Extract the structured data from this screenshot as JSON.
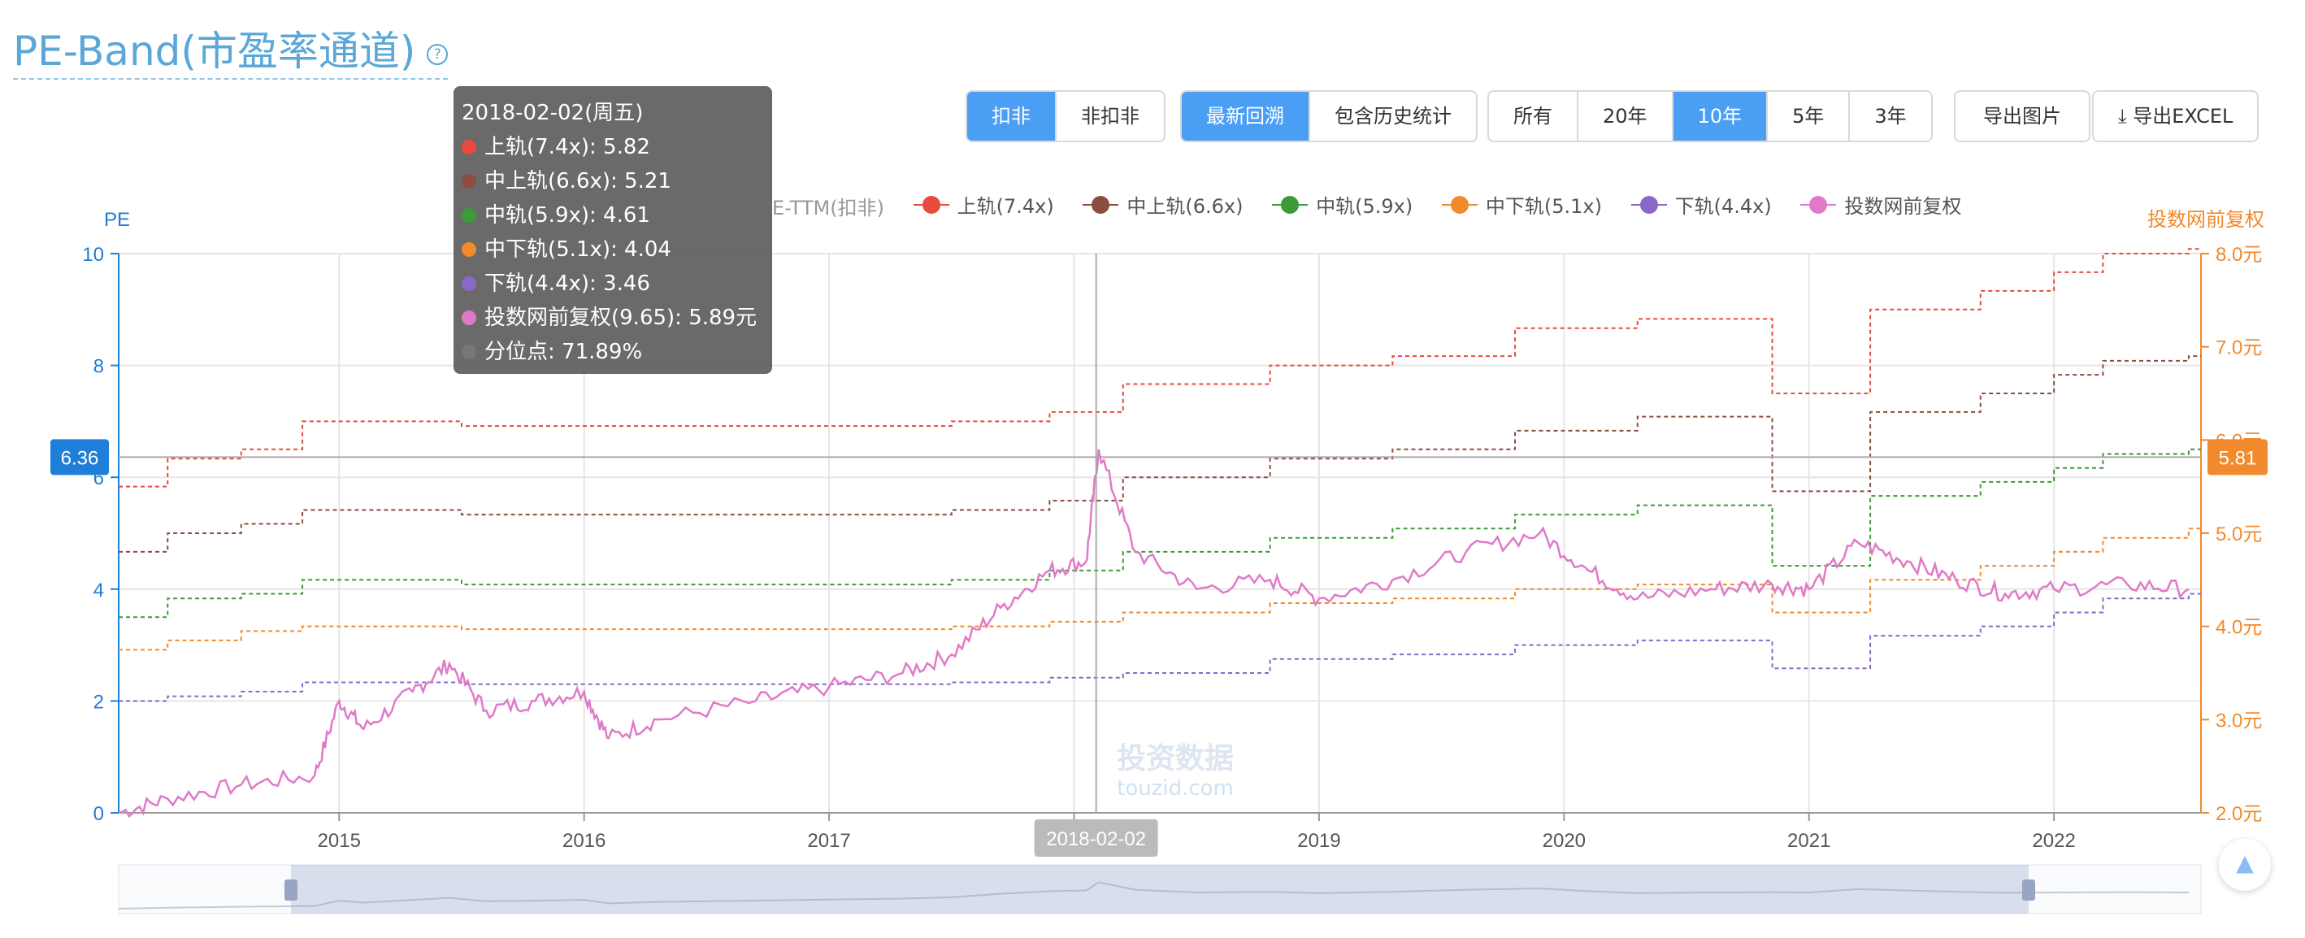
{
  "title": "PE-Band(市盈率通道)",
  "help_icon": "question-circle-icon",
  "controls": {
    "deduct_group": [
      {
        "label": "扣非",
        "active": true
      },
      {
        "label": "非扣非",
        "active": false
      }
    ],
    "method_group": [
      {
        "label": "最新回溯",
        "active": true
      },
      {
        "label": "包含历史统计",
        "active": false
      }
    ],
    "range_group": [
      {
        "label": "所有",
        "active": false
      },
      {
        "label": "20年",
        "active": false
      },
      {
        "label": "10年",
        "active": true
      },
      {
        "label": "5年",
        "active": false
      },
      {
        "label": "3年",
        "active": false
      }
    ],
    "export_image": "导出图片",
    "export_excel": "导出EXCEL",
    "export_excel_icon": "download-icon"
  },
  "legend_partial": "E-TTM(扣非)",
  "tooltip": {
    "date": "2018-02-02(周五)",
    "rows": [
      {
        "text": "上轨(7.4x): 5.82",
        "color": "#e84a3d"
      },
      {
        "text": "中上轨(6.6x): 5.21",
        "color": "#8b4d3f"
      },
      {
        "text": "中轨(5.9x): 4.61",
        "color": "#3b9b37"
      },
      {
        "text": "中下轨(5.1x): 4.04",
        "color": "#f08a2c"
      },
      {
        "text": "下轨(4.4x): 3.46",
        "color": "#8a68c8"
      },
      {
        "text": "投数网前复权(9.65): 5.89元",
        "color": "#e07ac8"
      },
      {
        "text": "分位点: 71.89%",
        "color": "#777777"
      }
    ]
  },
  "crosshair": {
    "left_value": "6.36",
    "right_value": "5.81",
    "x_label": "2018-02-02",
    "x_date": 2018.09
  },
  "watermark": {
    "main": "投资数据",
    "sub": "touzid.com"
  },
  "chart_data": {
    "type": "line",
    "x_ticks": [
      "2015",
      "2016",
      "2017",
      "2018",
      "2019",
      "2020",
      "2021",
      "2022"
    ],
    "x_range": [
      2014.1,
      2022.6
    ],
    "y_left": {
      "label": "PE",
      "range": [
        0,
        10
      ],
      "ticks": [
        "0",
        "2",
        "4",
        "6",
        "8",
        "10"
      ],
      "color": "#1f7ed8"
    },
    "y_right": {
      "label": "投数网前复权",
      "range": [
        2.0,
        8.0
      ],
      "ticks": [
        "2.0元",
        "3.0元",
        "4.0元",
        "5.0元",
        "6.0元",
        "7.0元",
        "8.0元"
      ],
      "color": "#f08a2c"
    },
    "legend": [
      {
        "name": "上轨(7.4x)",
        "color": "#e84a3d"
      },
      {
        "name": "中上轨(6.6x)",
        "color": "#8b4d3f"
      },
      {
        "name": "中轨(5.9x)",
        "color": "#3b9b37"
      },
      {
        "name": "中下轨(5.1x)",
        "color": "#f08a2c"
      },
      {
        "name": "下轨(4.4x)",
        "color": "#8a68c8"
      },
      {
        "name": "投数网前复权",
        "color": "#e07ac8"
      }
    ],
    "band_series": [
      {
        "name": "上轨(7.4x)",
        "color": "#e84a3d",
        "points": [
          [
            2014.1,
            5.5
          ],
          [
            2014.3,
            5.8
          ],
          [
            2014.6,
            5.9
          ],
          [
            2014.85,
            6.2
          ],
          [
            2015.5,
            6.15
          ],
          [
            2017.5,
            6.2
          ],
          [
            2017.9,
            6.3
          ],
          [
            2018.2,
            6.6
          ],
          [
            2018.8,
            6.8
          ],
          [
            2019.3,
            6.9
          ],
          [
            2019.8,
            7.2
          ],
          [
            2020.3,
            7.3
          ],
          [
            2020.85,
            6.5
          ],
          [
            2021.25,
            7.4
          ],
          [
            2021.7,
            7.6
          ],
          [
            2022.0,
            7.8
          ],
          [
            2022.2,
            8.0
          ],
          [
            2022.55,
            8.05
          ]
        ]
      },
      {
        "name": "中上轨(6.6x)",
        "color": "#8b4d3f",
        "points": [
          [
            2014.1,
            4.8
          ],
          [
            2014.3,
            5.0
          ],
          [
            2014.6,
            5.1
          ],
          [
            2014.85,
            5.25
          ],
          [
            2015.5,
            5.2
          ],
          [
            2017.5,
            5.25
          ],
          [
            2017.9,
            5.35
          ],
          [
            2018.2,
            5.6
          ],
          [
            2018.8,
            5.8
          ],
          [
            2019.3,
            5.9
          ],
          [
            2019.8,
            6.1
          ],
          [
            2020.3,
            6.25
          ],
          [
            2020.85,
            5.45
          ],
          [
            2021.25,
            6.3
          ],
          [
            2021.7,
            6.5
          ],
          [
            2022.0,
            6.7
          ],
          [
            2022.2,
            6.85
          ],
          [
            2022.55,
            6.9
          ]
        ]
      },
      {
        "name": "中轨(5.9x)",
        "color": "#3b9b37",
        "points": [
          [
            2014.1,
            4.1
          ],
          [
            2014.3,
            4.3
          ],
          [
            2014.6,
            4.35
          ],
          [
            2014.85,
            4.5
          ],
          [
            2015.5,
            4.45
          ],
          [
            2017.5,
            4.5
          ],
          [
            2017.9,
            4.6
          ],
          [
            2018.2,
            4.8
          ],
          [
            2018.8,
            4.95
          ],
          [
            2019.3,
            5.05
          ],
          [
            2019.8,
            5.2
          ],
          [
            2020.3,
            5.3
          ],
          [
            2020.85,
            4.65
          ],
          [
            2021.25,
            5.4
          ],
          [
            2021.7,
            5.55
          ],
          [
            2022.0,
            5.7
          ],
          [
            2022.2,
            5.85
          ],
          [
            2022.55,
            5.9
          ]
        ]
      },
      {
        "name": "中下轨(5.1x)",
        "color": "#f08a2c",
        "points": [
          [
            2014.1,
            3.75
          ],
          [
            2014.3,
            3.85
          ],
          [
            2014.6,
            3.95
          ],
          [
            2014.85,
            4.0
          ],
          [
            2015.5,
            3.97
          ],
          [
            2017.5,
            4.0
          ],
          [
            2017.9,
            4.05
          ],
          [
            2018.2,
            4.15
          ],
          [
            2018.8,
            4.25
          ],
          [
            2019.3,
            4.3
          ],
          [
            2019.8,
            4.4
          ],
          [
            2020.3,
            4.45
          ],
          [
            2020.85,
            4.15
          ],
          [
            2021.25,
            4.5
          ],
          [
            2021.7,
            4.65
          ],
          [
            2022.0,
            4.8
          ],
          [
            2022.2,
            4.95
          ],
          [
            2022.55,
            5.05
          ]
        ]
      },
      {
        "name": "下轨(4.4x)",
        "color": "#8a68c8",
        "points": [
          [
            2014.1,
            3.2
          ],
          [
            2014.3,
            3.25
          ],
          [
            2014.6,
            3.3
          ],
          [
            2014.85,
            3.4
          ],
          [
            2015.5,
            3.38
          ],
          [
            2017.5,
            3.4
          ],
          [
            2017.9,
            3.45
          ],
          [
            2018.2,
            3.5
          ],
          [
            2018.8,
            3.65
          ],
          [
            2019.3,
            3.7
          ],
          [
            2019.8,
            3.8
          ],
          [
            2020.3,
            3.85
          ],
          [
            2020.85,
            3.55
          ],
          [
            2021.25,
            3.9
          ],
          [
            2021.7,
            4.0
          ],
          [
            2022.0,
            4.15
          ],
          [
            2022.2,
            4.3
          ],
          [
            2022.55,
            4.35
          ]
        ]
      }
    ],
    "price_series": {
      "name": "投数网前复权",
      "color": "#e07ac8",
      "points": [
        [
          2014.1,
          2.0
        ],
        [
          2014.3,
          2.15
        ],
        [
          2014.6,
          2.3
        ],
        [
          2014.9,
          2.4
        ],
        [
          2015.0,
          3.2
        ],
        [
          2015.1,
          2.9
        ],
        [
          2015.3,
          3.3
        ],
        [
          2015.45,
          3.6
        ],
        [
          2015.6,
          3.1
        ],
        [
          2015.8,
          3.2
        ],
        [
          2016.0,
          3.3
        ],
        [
          2016.1,
          2.8
        ],
        [
          2016.3,
          3.0
        ],
        [
          2016.7,
          3.2
        ],
        [
          2017.0,
          3.35
        ],
        [
          2017.3,
          3.5
        ],
        [
          2017.5,
          3.7
        ],
        [
          2017.7,
          4.2
        ],
        [
          2017.9,
          4.6
        ],
        [
          2018.05,
          4.7
        ],
        [
          2018.1,
          5.9
        ],
        [
          2018.25,
          4.8
        ],
        [
          2018.5,
          4.4
        ],
        [
          2018.8,
          4.5
        ],
        [
          2019.0,
          4.3
        ],
        [
          2019.3,
          4.5
        ],
        [
          2019.6,
          4.8
        ],
        [
          2019.9,
          5.0
        ],
        [
          2020.1,
          4.6
        ],
        [
          2020.3,
          4.3
        ],
        [
          2020.6,
          4.4
        ],
        [
          2020.85,
          4.45
        ],
        [
          2021.0,
          4.4
        ],
        [
          2021.2,
          4.9
        ],
        [
          2021.4,
          4.7
        ],
        [
          2021.6,
          4.5
        ],
        [
          2021.8,
          4.35
        ],
        [
          2022.0,
          4.4
        ],
        [
          2022.3,
          4.45
        ],
        [
          2022.55,
          4.4
        ]
      ]
    }
  }
}
